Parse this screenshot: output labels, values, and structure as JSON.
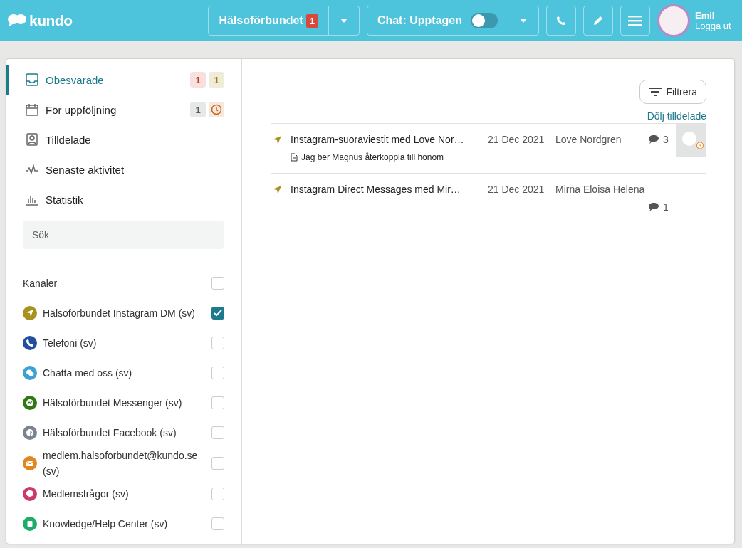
{
  "header": {
    "logo": "kundo",
    "org_button": {
      "label": "Hälsoförbundet",
      "badge": "1"
    },
    "chat_button": {
      "label": "Chat: Upptagen",
      "on": false
    },
    "user": {
      "name": "Emil",
      "logout": "Logga ut"
    }
  },
  "nav": [
    {
      "label": "Obesvarade",
      "selected": true,
      "badges": [
        {
          "kind": "count",
          "text": "1",
          "color": "#c0392b"
        },
        {
          "kind": "count",
          "text": "1",
          "color": "#9a7d0a"
        }
      ]
    },
    {
      "label": "För uppföljning",
      "selected": false,
      "badges": [
        {
          "kind": "count",
          "text": "1",
          "color": "#555b61"
        },
        {
          "kind": "clock",
          "color": "#c8641e"
        }
      ]
    },
    {
      "label": "Tilldelade",
      "selected": false
    },
    {
      "label": "Senaste aktivitet",
      "selected": false
    },
    {
      "label": "Statistik",
      "selected": false
    }
  ],
  "search": {
    "placeholder": "Sök"
  },
  "channels_header": {
    "label": "Kanaler",
    "checked": false
  },
  "channels": [
    {
      "label": "Hälsoförbundet Instagram DM (sv)",
      "color": "#a8921e",
      "checked": true
    },
    {
      "label": "Telefoni (sv)",
      "color": "#244ea0",
      "checked": false
    },
    {
      "label": "Chatta med oss (sv)",
      "color": "#3da1d2",
      "checked": false
    },
    {
      "label": "Hälsoförbundet Messenger (sv)",
      "color": "#2e7a12",
      "checked": false
    },
    {
      "label": "Hälsoförbundet Facebook (sv)",
      "color": "#7c8494",
      "checked": false
    },
    {
      "label": "medlem.halsoforbundet@kundo.se (sv)",
      "color": "#e0861c",
      "checked": false
    },
    {
      "label": "Medlemsfrågor (sv)",
      "color": "#cc3b68",
      "checked": false
    },
    {
      "label": "Knowledge/Help Center (sv)",
      "color": "#1dac6a",
      "checked": false
    }
  ],
  "filter_button": "Filtrera",
  "hide_assigned_link": "Dölj tilldelade",
  "conversations": [
    {
      "title": "Instagram-suoraviestit med Love Nor…",
      "date": "21 Dec 2021",
      "name": "Love Nordgren",
      "comments": "3",
      "note": "Jag ber Magnus återkoppla till honom",
      "assigned": true
    },
    {
      "title": "Instagram Direct Messages med Mir…",
      "date": "21 Dec 2021",
      "name": "Mirna Eloisa Helena",
      "comments": "1",
      "assigned": false
    }
  ]
}
